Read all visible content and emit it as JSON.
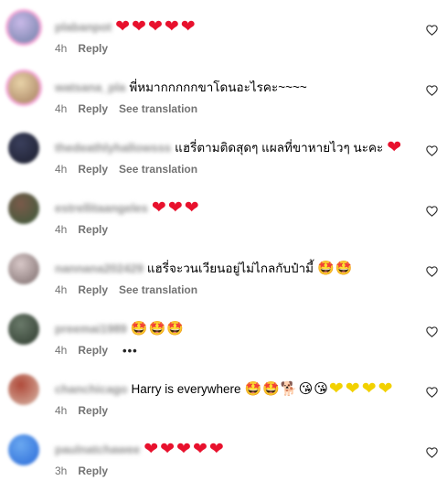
{
  "comments": [
    {
      "username": "plabanpot",
      "text": "",
      "emojis": [
        "heart",
        "heart",
        "heart",
        "heart",
        "heart"
      ],
      "time": "4h",
      "reply": "Reply",
      "translation": "",
      "more": "",
      "avatar": [
        "#c9b9e8",
        "#6f7ea6"
      ],
      "ring": true
    },
    {
      "username": "watsana_pla",
      "text": "พี่หมากกกกกขาโดนอะไรคะ~~~~",
      "emojis": [],
      "time": "4h",
      "reply": "Reply",
      "translation": "See translation",
      "more": "",
      "avatar": [
        "#e8d3a8",
        "#a47c5e"
      ],
      "ring": true
    },
    {
      "username": "thedeathlyhallowsss",
      "text": "แฮรี่ตามติดสุดๆ แผลที่ขาหายไวๆ นะคะ",
      "emojis": [
        "heart"
      ],
      "time": "4h",
      "reply": "Reply",
      "translation": "See translation",
      "more": "",
      "avatar": [
        "#3a3f5c",
        "#1c1e2e"
      ],
      "ring": false
    },
    {
      "username": "estrellitaangeles",
      "text": "",
      "emojis": [
        "heart",
        "heart",
        "heart"
      ],
      "time": "4h",
      "reply": "Reply",
      "translation": "",
      "more": "",
      "avatar": [
        "#7a5a4a",
        "#3a5a3a"
      ],
      "ring": false
    },
    {
      "username": "nannana202429",
      "text": "แฮรี่จะวนเวียนอยู่ไม่ไกลกับป๋ามี้",
      "emojis": [
        "star-eyes",
        "star-eyes"
      ],
      "time": "4h",
      "reply": "Reply",
      "translation": "See translation",
      "more": "",
      "avatar": [
        "#d8c8c8",
        "#7a6a6a"
      ],
      "ring": false
    },
    {
      "username": "preemai1989",
      "text": "",
      "emojis": [
        "star-eyes",
        "star-eyes",
        "star-eyes"
      ],
      "time": "4h",
      "reply": "Reply",
      "translation": "",
      "more": "•••",
      "avatar": [
        "#6a7a6a",
        "#2e3a2e"
      ],
      "ring": false
    },
    {
      "username": "chanchicago",
      "text": "Harry is everywhere",
      "emojis": [
        "star-eyes",
        "star-eyes",
        "dog",
        "kiss-face",
        "kiss-face",
        "yellow-heart",
        "yellow-heart",
        "yellow-heart",
        "yellow-heart"
      ],
      "time": "4h",
      "reply": "Reply",
      "translation": "",
      "more": "",
      "avatar": [
        "#b04a3a",
        "#d8b8a8"
      ],
      "ring": false
    },
    {
      "username": "paulnatchawee",
      "text": "",
      "emojis": [
        "heart",
        "heart",
        "heart",
        "heart",
        "heart"
      ],
      "time": "3h",
      "reply": "Reply",
      "translation": "",
      "more": "",
      "avatar": [
        "#6aa8f0",
        "#2a6ad8"
      ],
      "ring": false
    }
  ],
  "glyphs": {
    "heart": "❤",
    "yellow-heart": "❤",
    "star-eyes": "🤩",
    "kiss-face": "😘",
    "dog": "🐕"
  },
  "colors": {
    "heart": "#e8112d",
    "yellow-heart": "#f2d100",
    "muted": "#737373"
  }
}
